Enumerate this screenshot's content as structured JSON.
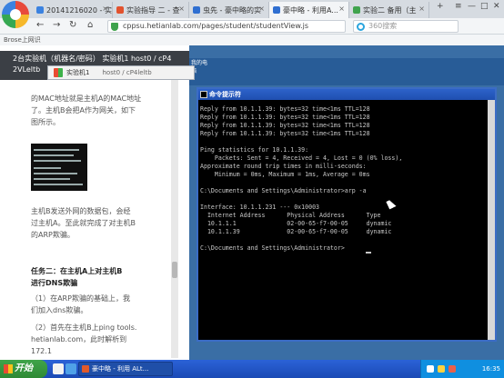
{
  "browser": {
    "tabs": [
      {
        "label": "20141216020 - 实",
        "color": "#3b82e0"
      },
      {
        "label": "实验指导 二 - 查",
        "color": "#e2522e"
      },
      {
        "label": "虫先 - 豪中略的实",
        "color": "#2f6fd1"
      },
      {
        "label": "豪中略 - 利用A...",
        "color": "#2f6fd1"
      },
      {
        "label": "实验二 备用（主",
        "color": "#3fa34d"
      }
    ],
    "url": "cppsu.hetianlab.com/pages/student/studentView.js",
    "search_placeholder": "360搜索",
    "bookmark_label": "Brose上网识",
    "controls": {
      "back": "←",
      "forward": "→",
      "reload": "↻",
      "home": "⌂"
    },
    "window_controls": {
      "menu": "≡",
      "min": "—",
      "max": "□",
      "close": "✕"
    }
  },
  "left_panel": {
    "header_line1": "2台实验机（机器名/密码）  实验机1   host0 / cP4",
    "header_line2": "2VLeltb",
    "para1_lines": [
      "的MAC地址就是主机A的MAC地址",
      "了。主机B会把A作为网关，如下",
      "图所示。"
    ],
    "para2_lines": [
      "主机B发送外网的数据包，会经",
      "过主机A。至此就完成了对主机B",
      "的ARP欺骗。"
    ],
    "task2_lines": [
      "任务二：在主机A上对主机B",
      "进行DNS欺骗"
    ],
    "step1_lines": [
      "（1）在ARP欺骗的基础上，我",
      "们加入dns欺骗。"
    ],
    "step2_lines": [
      "（2）首先在主机B上ping tools.",
      "hetianlab.com，此时解析到172.1"
    ]
  },
  "remote_tab": {
    "label": "实验机1",
    "path": "host0 / cP4leltb"
  },
  "remote": {
    "desktop_icon_label": "我的电脑",
    "cmd_title": "命令提示符",
    "lines": [
      "Reply from 10.1.1.39: bytes=32 time<1ms TTL=128",
      "Reply from 10.1.1.39: bytes=32 time<1ms TTL=128",
      "Reply from 10.1.1.39: bytes=32 time<1ms TTL=128",
      "Reply from 10.1.1.39: bytes=32 time<1ms TTL=128",
      "",
      "Ping statistics for 10.1.1.39:",
      "    Packets: Sent = 4, Received = 4, Lost = 0 (0% loss),",
      "Approximate round trip times in milli-seconds:",
      "    Minimum = 0ms, Maximum = 1ms, Average = 0ms",
      "",
      "C:\\Documents and Settings\\Administrator>arp -a",
      "",
      "Interface: 10.1.1.231 --- 0x10003",
      "  Internet Address      Physical Address      Type",
      "  10.1.1.1              02-00-65-f7-00-05     dynamic",
      "  10.1.1.39             02-00-65-f7-00-05     dynamic",
      "",
      "C:\\Documents and Settings\\Administrator>"
    ]
  },
  "taskbar": {
    "start_label": "开始",
    "task_button": "豪中略 - 利用 ALt...",
    "clock": "16:35"
  }
}
